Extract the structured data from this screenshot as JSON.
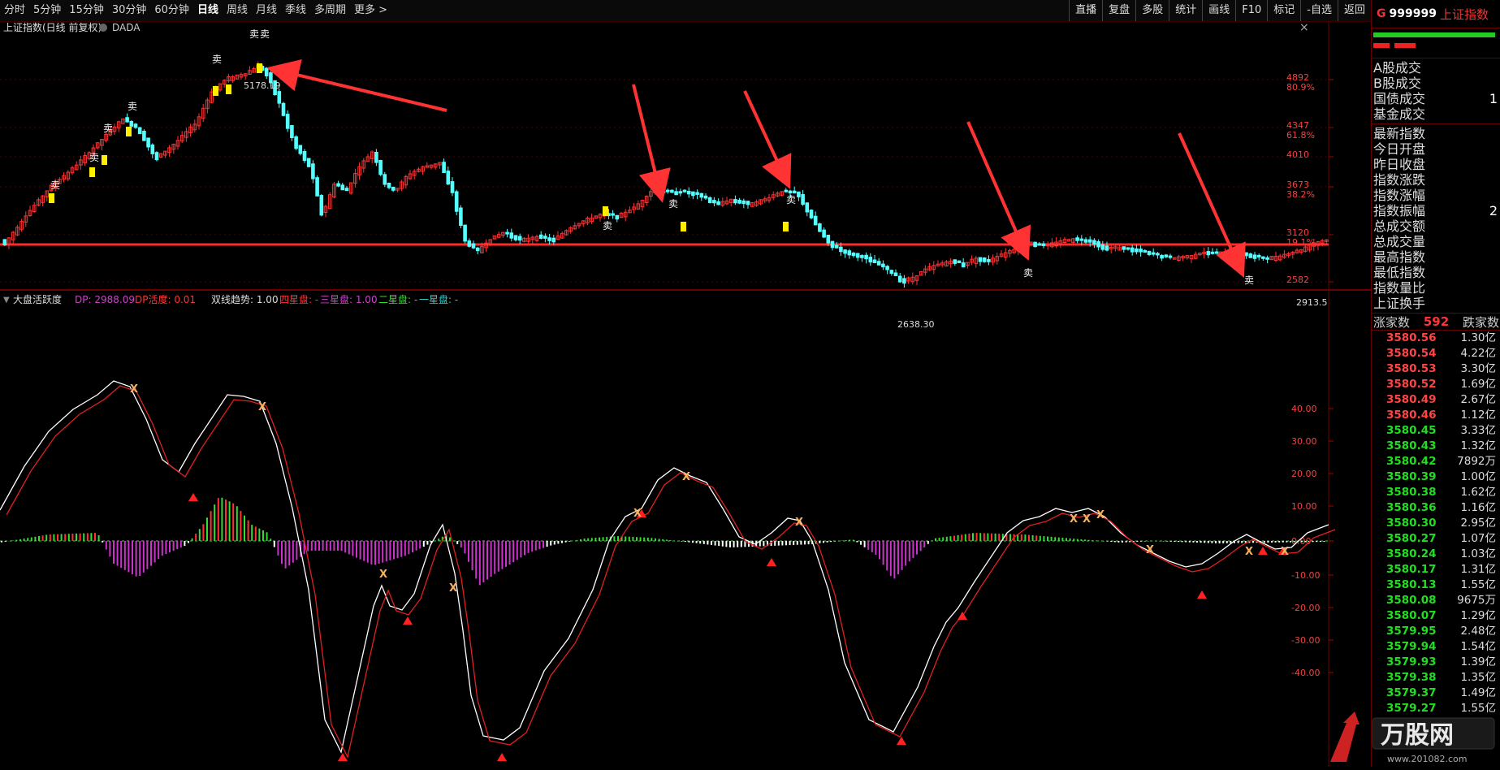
{
  "toolbar": {
    "periods": [
      "分时",
      "5分钟",
      "15分钟",
      "30分钟",
      "60分钟",
      "日线",
      "周线",
      "月线",
      "季线",
      "多周期",
      "更多 >"
    ],
    "active_period": "日线",
    "right_buttons": [
      "直播",
      "复盘",
      "多股",
      "统计",
      "画线",
      "F10",
      "标记",
      "-自选",
      "返回"
    ]
  },
  "chart": {
    "title": "上证指数(日线 前复权)",
    "overlay_name": "DADA",
    "high_label": "5178.19",
    "low_label": "2638.30",
    "last_label": "2913.5",
    "price_axis": [
      {
        "price": "4892",
        "pct": "80.9%"
      },
      {
        "price": "4347",
        "pct": "61.8%"
      },
      {
        "price": "4010",
        "pct": ""
      },
      {
        "price": "3673",
        "pct": "38.2%"
      },
      {
        "price": "3120",
        "pct": "19.1%"
      },
      {
        "price": "2582",
        "pct": ""
      }
    ],
    "sell_marker": "卖",
    "indicator": {
      "name": "大盘活跃度",
      "dp_label": "DP: 2988.09",
      "activity_label": "DP活度: 0.01",
      "dual_trend": "双线趋势: 1.00",
      "four_star": "四星盘: -",
      "three_star": "三星盘: 1.00",
      "two_star": "二星盘: -",
      "one_star": "一星盘: -",
      "axis": [
        "40.00",
        "30.00",
        "20.00",
        "10.00",
        "0.00",
        "-10.00",
        "-20.00",
        "-30.00",
        "-40.00"
      ]
    }
  },
  "panel": {
    "prefix": "G",
    "code": "999999",
    "name": "上证指数",
    "rows_a": [
      {
        "label": "A股成交",
        "value": ""
      },
      {
        "label": "B股成交",
        "value": ""
      },
      {
        "label": "国债成交",
        "value": "1"
      },
      {
        "label": "基金成交",
        "value": ""
      }
    ],
    "rows_b": [
      {
        "label": "最新指数",
        "value": ""
      },
      {
        "label": "今日开盘",
        "value": ""
      },
      {
        "label": "昨日收盘",
        "value": ""
      },
      {
        "label": "指数涨跌",
        "value": ""
      },
      {
        "label": "指数涨幅",
        "value": ""
      },
      {
        "label": "指数振幅",
        "value": "2"
      },
      {
        "label": "总成交额",
        "value": ""
      },
      {
        "label": "总成交量",
        "value": ""
      },
      {
        "label": "最高指数",
        "value": ""
      },
      {
        "label": "最低指数",
        "value": ""
      },
      {
        "label": "指数量比",
        "value": ""
      },
      {
        "label": "上证换手",
        "value": ""
      }
    ],
    "up_label": "涨家数",
    "up_count": "592",
    "down_label": "跌家数",
    "ticks": [
      {
        "price": "3580.56",
        "vol": "1.30亿"
      },
      {
        "price": "3580.54",
        "vol": "4.22亿"
      },
      {
        "price": "3580.53",
        "vol": "3.30亿"
      },
      {
        "price": "3580.52",
        "vol": "1.69亿"
      },
      {
        "price": "3580.49",
        "vol": "2.67亿"
      },
      {
        "price": "3580.46",
        "vol": "1.12亿"
      },
      {
        "price": "3580.45",
        "vol": "3.33亿"
      },
      {
        "price": "3580.43",
        "vol": "1.32亿"
      },
      {
        "price": "3580.42",
        "vol": "7892万"
      },
      {
        "price": "3580.39",
        "vol": "1.00亿"
      },
      {
        "price": "3580.38",
        "vol": "1.62亿"
      },
      {
        "price": "3580.36",
        "vol": "1.16亿"
      },
      {
        "price": "3580.30",
        "vol": "2.95亿"
      },
      {
        "price": "3580.27",
        "vol": "1.07亿"
      },
      {
        "price": "3580.24",
        "vol": "1.03亿"
      },
      {
        "price": "3580.17",
        "vol": "1.31亿"
      },
      {
        "price": "3580.13",
        "vol": "1.55亿"
      },
      {
        "price": "3580.08",
        "vol": "9675万"
      },
      {
        "price": "3580.07",
        "vol": "1.29亿"
      },
      {
        "price": "3579.95",
        "vol": "2.48亿"
      },
      {
        "price": "3579.94",
        "vol": "1.54亿"
      },
      {
        "price": "3579.93",
        "vol": "1.39亿"
      },
      {
        "price": "3579.38",
        "vol": "1.35亿"
      },
      {
        "price": "3579.37",
        "vol": "1.49亿"
      },
      {
        "price": "3579.27",
        "vol": "1.55亿"
      }
    ],
    "first_green_index": 6
  },
  "watermark": {
    "title": "万股网",
    "url": "www.201082.com"
  },
  "colors": {
    "up": "#ff3333",
    "down": "#54ffff",
    "sell_candle": "#ffee00",
    "ma": "#ff2222",
    "grid": "#5a0000",
    "magenta": "#cc33cc",
    "green": "#33dd33"
  },
  "icons": {
    "close": "close-icon",
    "dropdown": "chevron-down-icon"
  }
}
